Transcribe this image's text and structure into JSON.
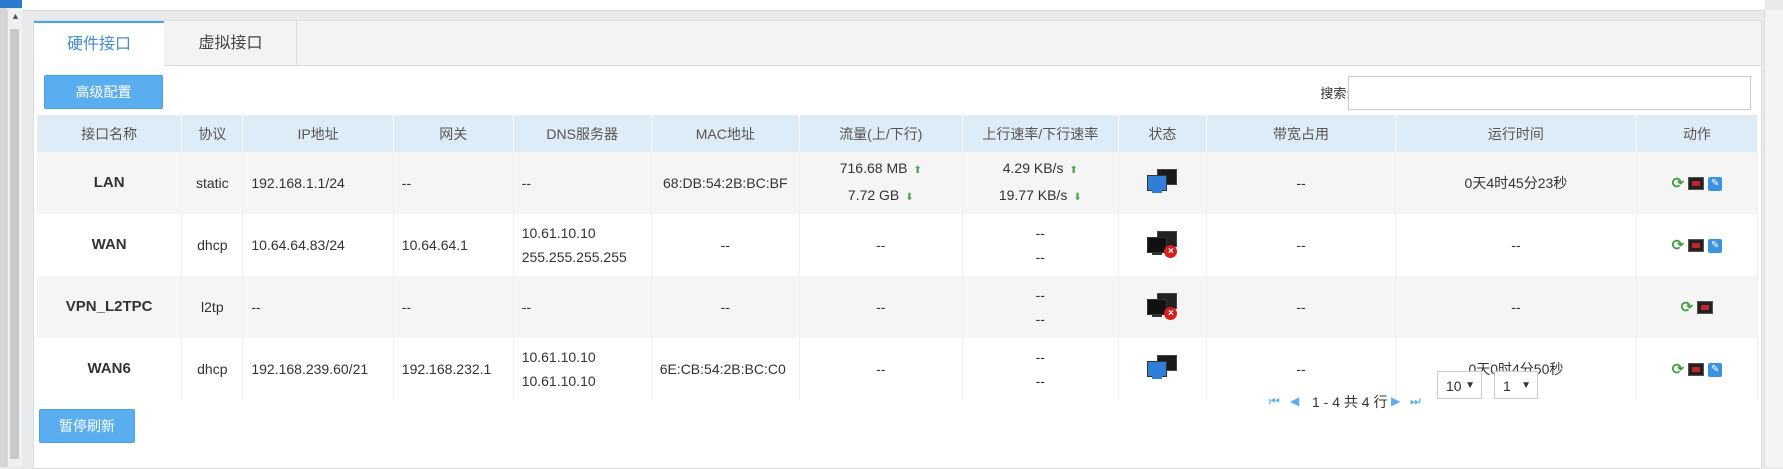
{
  "tabs": [
    {
      "label": "硬件接口",
      "active": true
    },
    {
      "label": "虚拟接口",
      "active": false
    }
  ],
  "toolbar": {
    "advanced_label": "高级配置",
    "search_label": "搜索:",
    "search_value": "",
    "pause_label": "暂停刷新"
  },
  "table": {
    "headers": [
      "接口名称",
      "协议",
      "IP地址",
      "网关",
      "DNS服务器",
      "MAC地址",
      "流量(上/下行)",
      "上行速率/下行速率",
      "状态",
      "带宽占用",
      "运行时间",
      "动作"
    ],
    "rows": [
      {
        "name": "LAN",
        "protocol": "static",
        "ip": "192.168.1.1/24",
        "gateway": "--",
        "dns1": "--",
        "dns2": "",
        "mac": "68:DB:54:2B:BC:BF",
        "traffic_up": "716.68 MB",
        "traffic_down": "7.72 GB",
        "rate_up": "4.29 KB/s",
        "rate_down": "19.77 KB/s",
        "status": "connected",
        "bandwidth": "--",
        "uptime": "0天4时45分23秒",
        "actions": [
          "refresh-icon",
          "monitor-icon",
          "edit-icon"
        ]
      },
      {
        "name": "WAN",
        "protocol": "dhcp",
        "ip": "10.64.64.83/24",
        "gateway": "10.64.64.1",
        "dns1": "10.61.10.10",
        "dns2": "255.255.255.255",
        "mac": "--",
        "traffic_up": "--",
        "traffic_down": "",
        "rate_up": "--",
        "rate_down": "--",
        "status": "disconnected",
        "bandwidth": "--",
        "uptime": "--",
        "actions": [
          "refresh-icon",
          "monitor-icon",
          "edit-icon"
        ]
      },
      {
        "name": "VPN_L2TPC",
        "protocol": "l2tp",
        "ip": "--",
        "gateway": "--",
        "dns1": "--",
        "dns2": "",
        "mac": "--",
        "traffic_up": "--",
        "traffic_down": "",
        "rate_up": "--",
        "rate_down": "--",
        "status": "disconnected",
        "bandwidth": "--",
        "uptime": "--",
        "actions": [
          "refresh-icon",
          "monitor-icon"
        ]
      },
      {
        "name": "WAN6",
        "protocol": "dhcp",
        "ip": "192.168.239.60/21",
        "gateway": "192.168.232.1",
        "dns1": "10.61.10.10",
        "dns2": "10.61.10.10",
        "mac": "6E:CB:54:2B:BC:C0",
        "traffic_up": "--",
        "traffic_down": "",
        "rate_up": "--",
        "rate_down": "--",
        "status": "connected",
        "bandwidth": "--",
        "uptime": "0天0时4分50秒",
        "actions": [
          "refresh-icon",
          "monitor-icon",
          "edit-icon"
        ]
      }
    ]
  },
  "pagination": {
    "summary": "1 - 4 共 4 行",
    "page_size": "10",
    "page": "1"
  },
  "colors": {
    "accent": "#5aaef0",
    "header_bg": "#deecf8",
    "status_ok": "#2f7fd6",
    "status_bad": "#d62020"
  }
}
